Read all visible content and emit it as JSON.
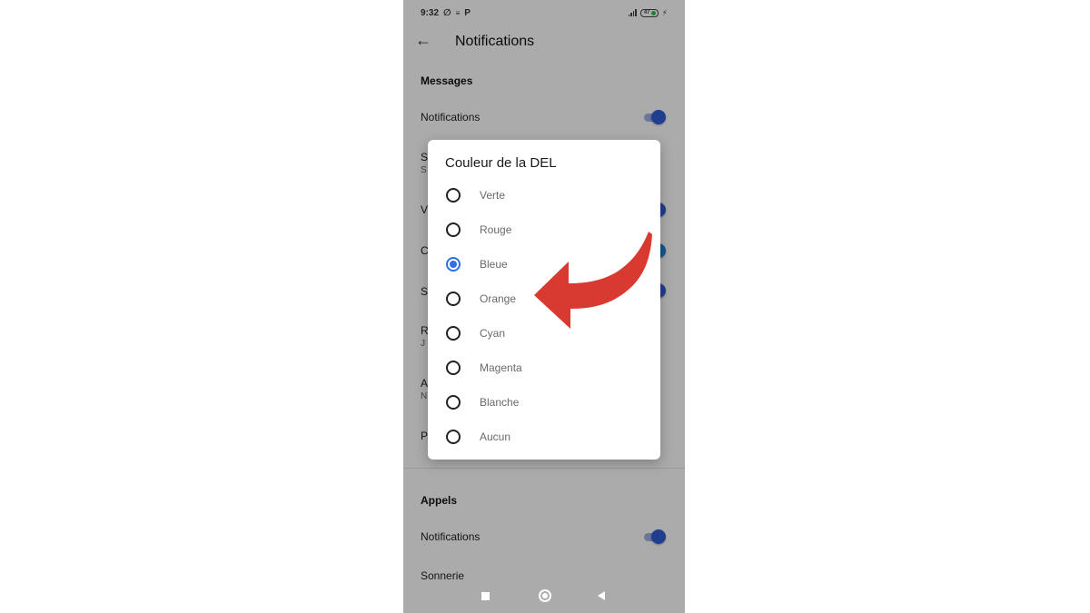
{
  "status_bar": {
    "time": "9:32",
    "icons": [
      "muted-bell-icon",
      "notification-icon",
      "p-app-icon"
    ],
    "battery_level": "47",
    "charging": true
  },
  "app_bar": {
    "back_icon": "arrow-left-icon",
    "title": "Notifications"
  },
  "sections": {
    "messages": {
      "header": "Messages",
      "notifications_label": "Notifications",
      "notifications_on": true,
      "partial_rows": [
        {
          "title": "S",
          "subtitle": "S"
        },
        {
          "title": "V",
          "toggle_on": true
        },
        {
          "title": "C",
          "toggle_on": true
        },
        {
          "title": "S",
          "toggle_on": true
        },
        {
          "title": "R",
          "subtitle": "J"
        },
        {
          "title": "A",
          "subtitle": "N"
        },
        {
          "title": "P"
        }
      ]
    },
    "calls": {
      "header": "Appels",
      "notifications_label": "Notifications",
      "notifications_on": true,
      "ringtone_label": "Sonnerie"
    }
  },
  "dialog": {
    "title": "Couleur de la DEL",
    "selected": "Bleue",
    "options": [
      {
        "label": "Verte",
        "checked": false
      },
      {
        "label": "Rouge",
        "checked": false
      },
      {
        "label": "Bleue",
        "checked": true
      },
      {
        "label": "Orange",
        "checked": false
      },
      {
        "label": "Cyan",
        "checked": false
      },
      {
        "label": "Magenta",
        "checked": false
      },
      {
        "label": "Blanche",
        "checked": false
      },
      {
        "label": "Aucun",
        "checked": false
      }
    ]
  },
  "annotation": {
    "type": "curved-arrow",
    "color": "#d93a2f",
    "points_to": "Orange"
  },
  "nav_bar": {
    "buttons": [
      "recents-square-icon",
      "home-circle-icon",
      "back-triangle-icon"
    ]
  }
}
